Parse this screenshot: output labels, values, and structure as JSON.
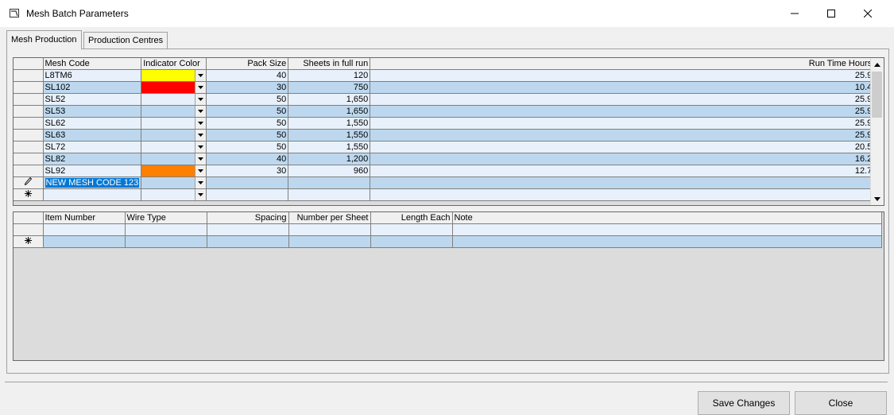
{
  "window": {
    "title": "Mesh Batch Parameters"
  },
  "tabs": [
    {
      "label": "Mesh Production"
    },
    {
      "label": "Production Centres"
    }
  ],
  "mesh_grid": {
    "columns": [
      "Mesh Code",
      "Indicator Color",
      "Pack Size",
      "Sheets in full run",
      "Run Time Hours"
    ],
    "rows": [
      {
        "code": "L8TM6",
        "color": "#ffff00",
        "pack": "40",
        "sheets": "120",
        "hours": "25.9"
      },
      {
        "code": "SL102",
        "color": "#ff0000",
        "pack": "30",
        "sheets": "750",
        "hours": "10.4"
      },
      {
        "code": "SL52",
        "color": "",
        "pack": "50",
        "sheets": "1,650",
        "hours": "25.9"
      },
      {
        "code": "SL53",
        "color": "",
        "pack": "50",
        "sheets": "1,650",
        "hours": "25.9"
      },
      {
        "code": "SL62",
        "color": "",
        "pack": "50",
        "sheets": "1,550",
        "hours": "25.9"
      },
      {
        "code": "SL63",
        "color": "",
        "pack": "50",
        "sheets": "1,550",
        "hours": "25.9"
      },
      {
        "code": "SL72",
        "color": "",
        "pack": "50",
        "sheets": "1,550",
        "hours": "20.5"
      },
      {
        "code": "SL82",
        "color": "",
        "pack": "40",
        "sheets": "1,200",
        "hours": "16.2"
      },
      {
        "code": "SL92",
        "color": "#ff8000",
        "pack": "30",
        "sheets": "960",
        "hours": "12.7"
      }
    ],
    "editing_row": {
      "code": "NEW MESH CODE 123"
    }
  },
  "item_grid": {
    "columns": [
      "Item Number",
      "Wire Type",
      "Spacing",
      "Number per Sheet",
      "Length Each",
      "Note"
    ]
  },
  "buttons": {
    "save": "Save Changes",
    "close": "Close"
  }
}
